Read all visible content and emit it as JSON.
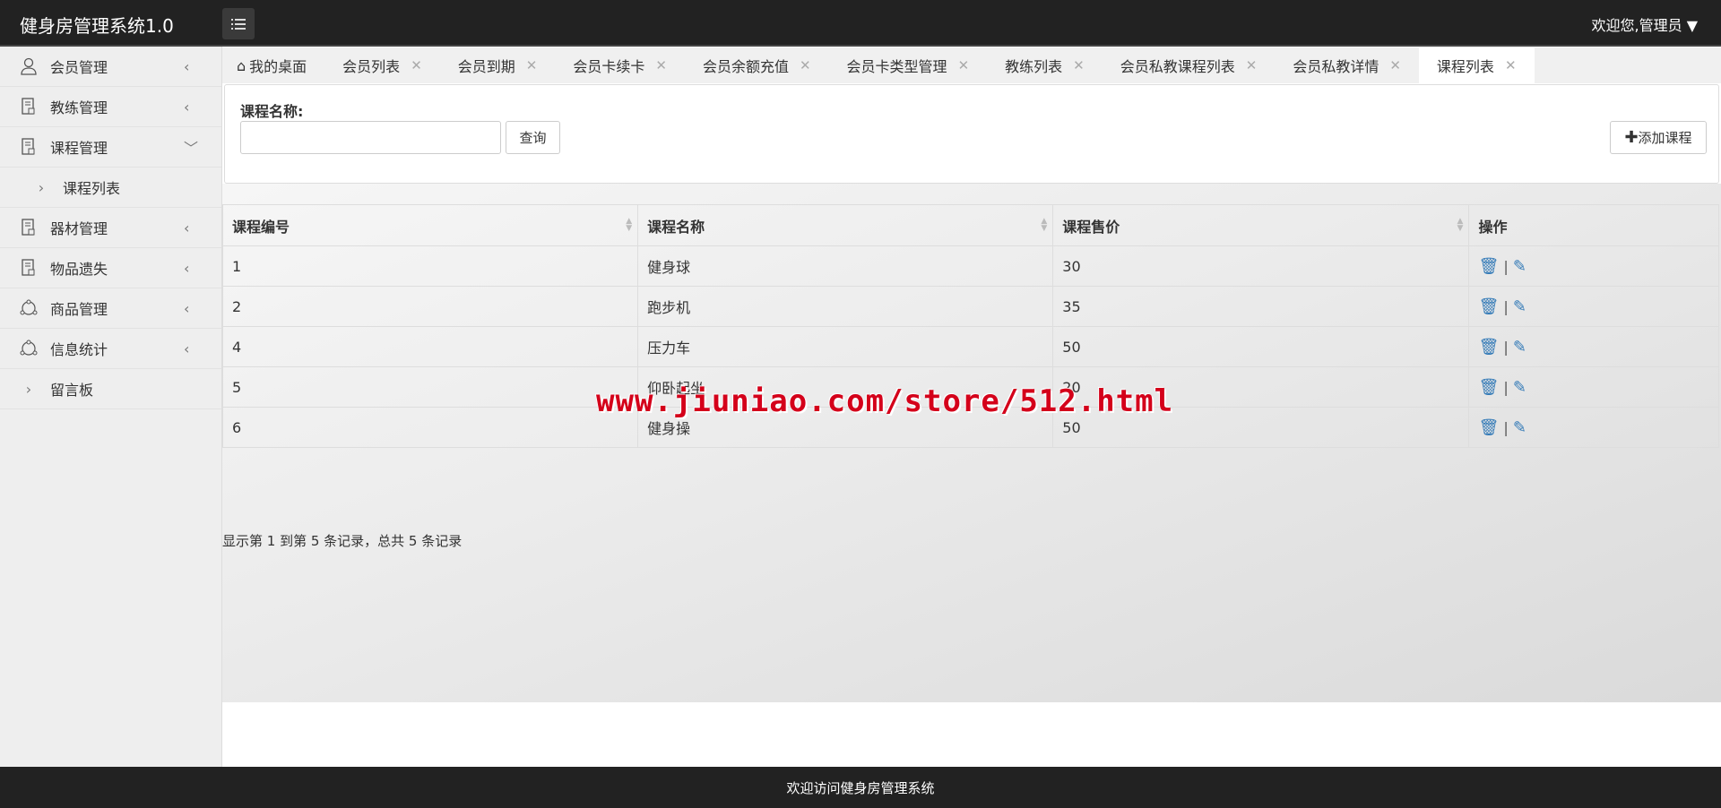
{
  "header": {
    "title": "健身房管理系统1.0",
    "user": "欢迎您,管理员"
  },
  "sidebar": {
    "items": [
      {
        "label": "会员管理",
        "icon": "user-icon",
        "arrow": "<"
      },
      {
        "label": "教练管理",
        "icon": "document-icon",
        "arrow": "<"
      },
      {
        "label": "课程管理",
        "icon": "document-icon",
        "arrow": "v"
      },
      {
        "label": "课程列表",
        "icon": "chevron-right-icon",
        "sub": true
      },
      {
        "label": "器材管理",
        "icon": "document-icon",
        "arrow": "<"
      },
      {
        "label": "物品遗失",
        "icon": "document-icon",
        "arrow": "<"
      },
      {
        "label": "商品管理",
        "icon": "share-icon",
        "arrow": "<"
      },
      {
        "label": "信息统计",
        "icon": "share-icon",
        "arrow": "<"
      },
      {
        "label": "留言板",
        "icon": "chevron-right-icon"
      }
    ]
  },
  "tabs": [
    "我的桌面",
    "会员列表",
    "会员到期",
    "会员卡续卡",
    "会员余额充值",
    "会员卡类型管理",
    "教练列表",
    "会员私教课程列表",
    "会员私教详情",
    "课程列表"
  ],
  "search": {
    "label": "课程名称:",
    "value": "",
    "query_button": "查询",
    "add_button": "添加课程"
  },
  "table": {
    "columns": [
      "课程编号",
      "课程名称",
      "课程售价",
      "操作"
    ],
    "rows": [
      [
        "1",
        "健身球",
        "30"
      ],
      [
        "2",
        "跑步机",
        "35"
      ],
      [
        "4",
        "压力车",
        "50"
      ],
      [
        "5",
        "仰卧起坐",
        "20"
      ],
      [
        "6",
        "健身操",
        "50"
      ]
    ]
  },
  "pager": "显示第 1 到第 5 条记录，总共 5 条记录",
  "watermark": "www.jiuniao.com/store/512.html",
  "footer": "欢迎访问健身房管理系统"
}
